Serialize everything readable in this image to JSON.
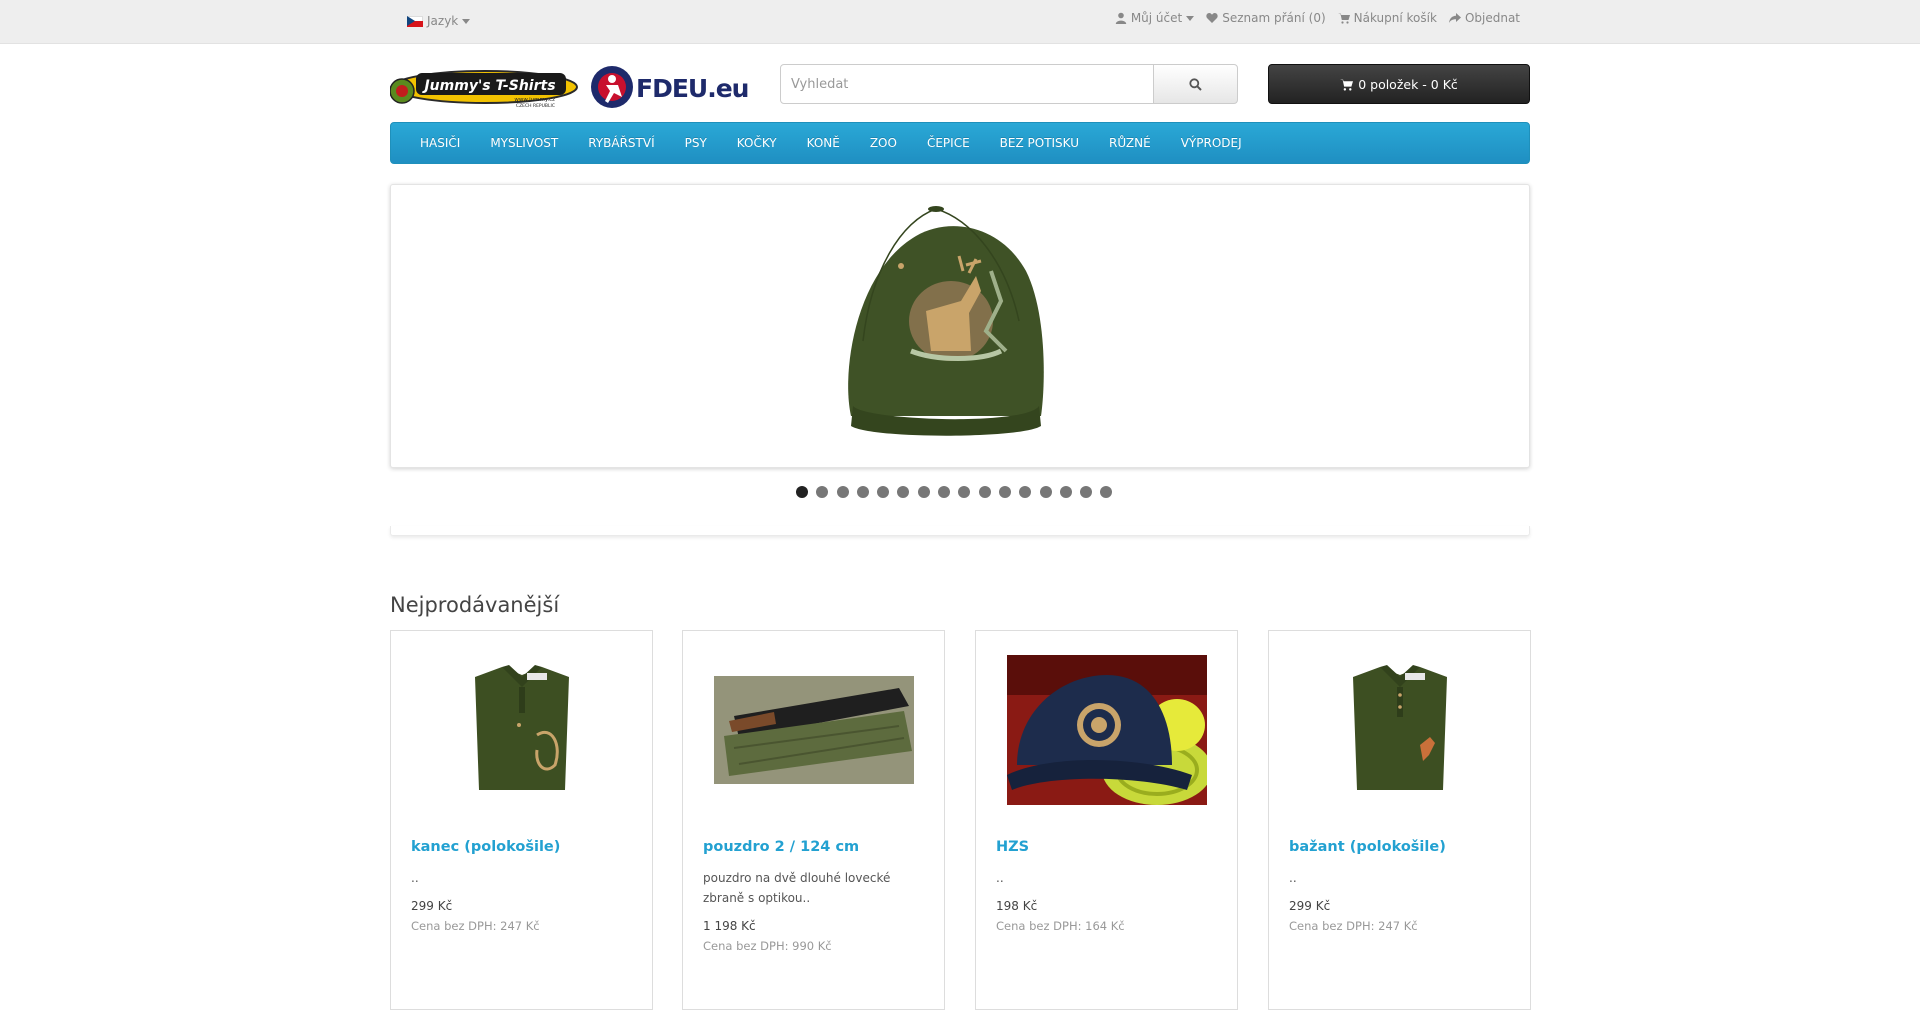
{
  "topbar": {
    "language_label": "Jazyk",
    "account_label": "Můj účet",
    "wishlist_label": "Seznam přání (0)",
    "cart_label": "Nákupní košík",
    "checkout_label": "Objednat"
  },
  "header": {
    "logo1_text": "Jummy's T-Shirts",
    "logo1_sub": "www.jummy.cz",
    "logo1_sub2": "CZECH REPUBLIC",
    "logo2_text": "FDEU.eu",
    "search_placeholder": "Vyhledat",
    "cart_button": "0 položek - 0 Kč"
  },
  "menu": {
    "items": [
      "HASIČI",
      "MYSLIVOST",
      "RYBÁŘSTVÍ",
      "PSY",
      "KOČKY",
      "KONĚ",
      "ZOO",
      "ČEPICE",
      "BEZ POTISKU",
      "RŮZNÉ",
      "VÝPRODEJ"
    ]
  },
  "slider": {
    "active_index": 0,
    "dot_count": 16
  },
  "bestsellers": {
    "heading": "Nejprodávanější",
    "products": [
      {
        "name": "kanec (polokošile)",
        "desc": "..",
        "price": "299 Kč",
        "tax": "Cena bez DPH: 247 Kč"
      },
      {
        "name": "pouzdro 2 / 124 cm",
        "desc": "pouzdro na dvě dlouhé lovecké zbraně s optikou..",
        "price": "1 198 Kč",
        "tax": "Cena bez DPH: 990 Kč"
      },
      {
        "name": "HZS",
        "desc": "..",
        "price": "198 Kč",
        "tax": "Cena bez DPH: 164 Kč"
      },
      {
        "name": "bažant (polokošile)",
        "desc": "..",
        "price": "299 Kč",
        "tax": "Cena bez DPH: 247 Kč"
      }
    ]
  },
  "colors": {
    "accent": "#23a1d1",
    "menu_bg": "#2aa8d6",
    "topbar_bg": "#eeeeee"
  }
}
